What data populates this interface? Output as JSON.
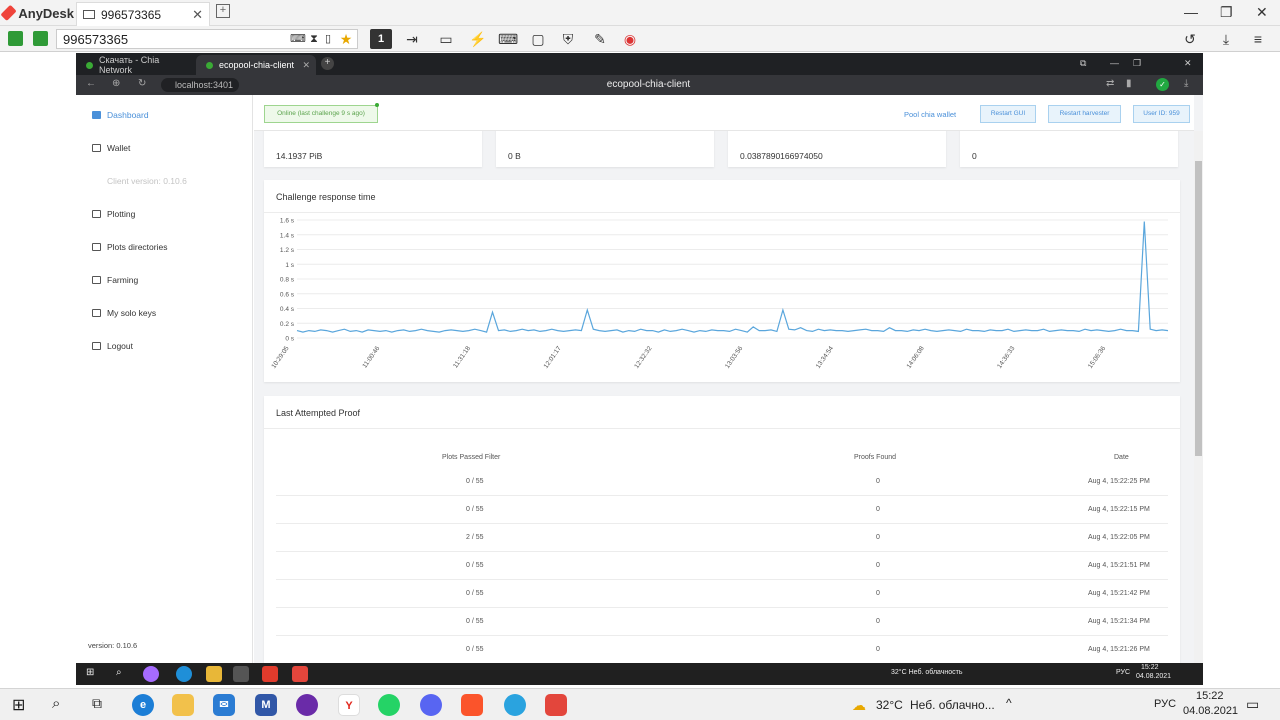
{
  "anydesk": {
    "app_name": "AnyDesk",
    "tab_label": "996573365",
    "address_value": "996573365",
    "toolbar_badge": "1"
  },
  "browser": {
    "tab1": "Скачать - Chia Network",
    "tab2": "ecopool-chia-client",
    "address": "localhost:3401",
    "title": "ecopool-chia-client"
  },
  "sidebar": {
    "items": [
      {
        "label": "Dashboard",
        "icon": "dashboard-icon"
      },
      {
        "label": "Wallet",
        "icon": "wallet-icon"
      },
      {
        "label": "Client version: 0.10.6",
        "icon": ""
      },
      {
        "label": "Plotting",
        "icon": "plotting-icon"
      },
      {
        "label": "Plots directories",
        "icon": "folder-icon"
      },
      {
        "label": "Farming",
        "icon": "farming-icon"
      },
      {
        "label": "My solo keys",
        "icon": "key-icon"
      },
      {
        "label": "Logout",
        "icon": "logout-icon"
      }
    ],
    "version": "version: 0.10.6"
  },
  "topbar": {
    "status": "Online (last challenge 9 s ago)",
    "pool_link": "Pool chia wallet",
    "restart_gui": "Restart GUI",
    "restart_harvester": "Restart harvester",
    "user_id": "User ID: 959"
  },
  "stats": [
    "14.1937 PiB",
    "0 B",
    "0.0387890166974050",
    "0"
  ],
  "chart_card": {
    "title": "Challenge response time"
  },
  "chart_data": {
    "type": "line",
    "title": "Challenge response time",
    "xlabel": "",
    "ylabel": "",
    "ylim": [
      0,
      1.6
    ],
    "y_ticks": [
      "0 s",
      "0.2 s",
      "0.4 s",
      "0.6 s",
      "0.8 s",
      "1 s",
      "1.2 s",
      "1.4 s",
      "1.6 s"
    ],
    "x_ticks": [
      "10:29:05",
      "11:00:46",
      "11:31:18",
      "12:01:17",
      "12:32:32",
      "13:03:56",
      "13:34:54",
      "14:06:08",
      "14:36:33",
      "15:06:36"
    ],
    "series": [
      {
        "color": "#5aa6dc",
        "values": [
          0.1,
          0.08,
          0.1,
          0.09,
          0.11,
          0.1,
          0.08,
          0.1,
          0.12,
          0.09,
          0.1,
          0.08,
          0.11,
          0.1,
          0.09,
          0.1,
          0.08,
          0.1,
          0.11,
          0.09,
          0.1,
          0.12,
          0.1,
          0.09,
          0.08,
          0.1,
          0.11,
          0.1,
          0.09,
          0.1,
          0.12,
          0.1,
          0.08,
          0.35,
          0.1,
          0.11,
          0.09,
          0.1,
          0.12,
          0.1,
          0.11,
          0.09,
          0.1,
          0.12,
          0.1,
          0.09,
          0.1,
          0.11,
          0.1,
          0.38,
          0.12,
          0.1,
          0.09,
          0.1,
          0.11,
          0.08,
          0.1,
          0.09,
          0.12,
          0.1,
          0.1,
          0.08,
          0.11,
          0.09,
          0.1,
          0.12,
          0.1,
          0.08,
          0.1,
          0.09,
          0.11,
          0.1,
          0.1,
          0.09,
          0.12,
          0.1,
          0.08,
          0.15,
          0.1,
          0.1,
          0.11,
          0.09,
          0.38,
          0.12,
          0.11,
          0.14,
          0.1,
          0.09,
          0.12,
          0.1,
          0.11,
          0.1,
          0.1,
          0.09,
          0.1,
          0.11,
          0.12,
          0.1,
          0.1,
          0.09,
          0.14,
          0.1,
          0.1,
          0.09,
          0.11,
          0.1,
          0.12,
          0.1,
          0.09,
          0.1,
          0.11,
          0.1,
          0.09,
          0.12,
          0.1,
          0.1,
          0.09,
          0.11,
          0.1,
          0.1,
          0.12,
          0.09,
          0.1,
          0.11,
          0.1,
          0.1,
          0.12,
          0.09,
          0.1,
          0.11,
          0.1,
          0.1,
          0.09,
          0.12,
          0.1,
          0.11,
          0.1,
          0.09,
          0.1,
          0.12,
          0.1,
          0.1,
          0.09,
          1.58,
          0.12,
          0.1,
          0.11,
          0.1
        ]
      }
    ],
    "grid": true
  },
  "proofs": {
    "title": "Last Attempted Proof",
    "columns": [
      "Plots Passed Filter",
      "Proofs Found",
      "Date"
    ],
    "rows": [
      [
        "0 / 55",
        "0",
        "Aug 4, 15:22:25 PM"
      ],
      [
        "0 / 55",
        "0",
        "Aug 4, 15:22:15 PM"
      ],
      [
        "2 / 55",
        "0",
        "Aug 4, 15:22:05 PM"
      ],
      [
        "0 / 55",
        "0",
        "Aug 4, 15:21:51 PM"
      ],
      [
        "0 / 55",
        "0",
        "Aug 4, 15:21:42 PM"
      ],
      [
        "0 / 55",
        "0",
        "Aug 4, 15:21:34 PM"
      ],
      [
        "0 / 55",
        "0",
        "Aug 4, 15:21:26 PM"
      ]
    ]
  },
  "remote_taskbar": {
    "weather": "32°C  Неб. облачность",
    "lang": "РУС",
    "time": "15:22",
    "date": "04.08.2021"
  },
  "taskbar": {
    "weather_temp": "32°C",
    "weather_text": "Неб. облачно...",
    "lang": "РУС",
    "time": "15:22",
    "date": "04.08.2021"
  }
}
